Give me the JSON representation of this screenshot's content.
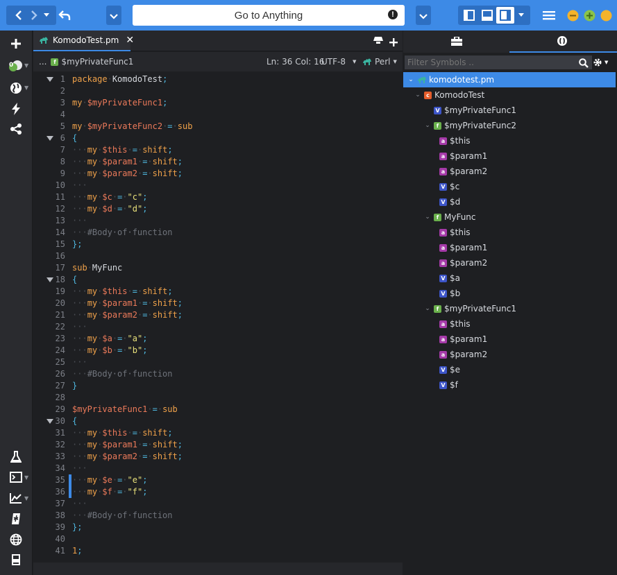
{
  "toolbar": {
    "goto_placeholder": "Go to Anything",
    "warning_glyph": "!"
  },
  "rail": {
    "badge_count": "0"
  },
  "editor_tab": {
    "filename": "KomodoTest.pm",
    "close": "✕"
  },
  "breadcrumb": {
    "ellipsis": "...",
    "symbol": "$myPrivateFunc1",
    "position": "Ln: 36 Col: 16",
    "encoding": "UTF-8",
    "language": "Perl"
  },
  "code_lines": [
    {
      "n": "1",
      "fold": true,
      "parts": [
        [
          "kw",
          "package"
        ],
        [
          "ws",
          "·"
        ],
        [
          "plain",
          "KomodoTest"
        ],
        [
          "op",
          ";"
        ]
      ]
    },
    {
      "n": "2",
      "parts": []
    },
    {
      "n": "3",
      "parts": [
        [
          "kw",
          "my"
        ],
        [
          "ws",
          "·"
        ],
        [
          "var",
          "$myPrivateFunc1"
        ],
        [
          "op",
          ";"
        ]
      ]
    },
    {
      "n": "4",
      "parts": []
    },
    {
      "n": "5",
      "parts": [
        [
          "kw",
          "my"
        ],
        [
          "ws",
          "·"
        ],
        [
          "var",
          "$myPrivateFunc2"
        ],
        [
          "ws",
          "·"
        ],
        [
          "op",
          "="
        ],
        [
          "ws",
          "·"
        ],
        [
          "kw",
          "sub"
        ]
      ]
    },
    {
      "n": "6",
      "fold": true,
      "parts": [
        [
          "op",
          "{"
        ]
      ]
    },
    {
      "n": "7",
      "parts": [
        [
          "ws",
          "···"
        ],
        [
          "kw",
          "my"
        ],
        [
          "ws",
          "·"
        ],
        [
          "var",
          "$this"
        ],
        [
          "ws",
          "·"
        ],
        [
          "op",
          "="
        ],
        [
          "ws",
          "·"
        ],
        [
          "kw",
          "shift"
        ],
        [
          "op",
          ";"
        ]
      ]
    },
    {
      "n": "8",
      "parts": [
        [
          "ws",
          "···"
        ],
        [
          "kw",
          "my"
        ],
        [
          "ws",
          "·"
        ],
        [
          "var",
          "$param1"
        ],
        [
          "ws",
          "·"
        ],
        [
          "op",
          "="
        ],
        [
          "ws",
          "·"
        ],
        [
          "kw",
          "shift"
        ],
        [
          "op",
          ";"
        ]
      ]
    },
    {
      "n": "9",
      "parts": [
        [
          "ws",
          "···"
        ],
        [
          "kw",
          "my"
        ],
        [
          "ws",
          "·"
        ],
        [
          "var",
          "$param2"
        ],
        [
          "ws",
          "·"
        ],
        [
          "op",
          "="
        ],
        [
          "ws",
          "·"
        ],
        [
          "kw",
          "shift"
        ],
        [
          "op",
          ";"
        ]
      ]
    },
    {
      "n": "10",
      "parts": [
        [
          "ws",
          "···"
        ]
      ]
    },
    {
      "n": "11",
      "parts": [
        [
          "ws",
          "···"
        ],
        [
          "kw",
          "my"
        ],
        [
          "ws",
          "·"
        ],
        [
          "var",
          "$c"
        ],
        [
          "ws",
          "·"
        ],
        [
          "op",
          "="
        ],
        [
          "ws",
          "·"
        ],
        [
          "str",
          "\"c\""
        ],
        [
          "op",
          ";"
        ]
      ]
    },
    {
      "n": "12",
      "parts": [
        [
          "ws",
          "···"
        ],
        [
          "kw",
          "my"
        ],
        [
          "ws",
          "·"
        ],
        [
          "var",
          "$d"
        ],
        [
          "ws",
          "·"
        ],
        [
          "op",
          "="
        ],
        [
          "ws",
          "·"
        ],
        [
          "str",
          "\"d\""
        ],
        [
          "op",
          ";"
        ]
      ]
    },
    {
      "n": "13",
      "parts": [
        [
          "ws",
          "···"
        ]
      ]
    },
    {
      "n": "14",
      "parts": [
        [
          "ws",
          "···"
        ],
        [
          "cm",
          "#Body·of·function"
        ]
      ]
    },
    {
      "n": "15",
      "parts": [
        [
          "op",
          "};"
        ]
      ]
    },
    {
      "n": "16",
      "parts": []
    },
    {
      "n": "17",
      "parts": [
        [
          "kw",
          "sub"
        ],
        [
          "ws",
          "·"
        ],
        [
          "plain",
          "MyFunc"
        ]
      ]
    },
    {
      "n": "18",
      "fold": true,
      "parts": [
        [
          "op",
          "{"
        ]
      ]
    },
    {
      "n": "19",
      "parts": [
        [
          "ws",
          "···"
        ],
        [
          "kw",
          "my"
        ],
        [
          "ws",
          "·"
        ],
        [
          "var",
          "$this"
        ],
        [
          "ws",
          "·"
        ],
        [
          "op",
          "="
        ],
        [
          "ws",
          "·"
        ],
        [
          "kw",
          "shift"
        ],
        [
          "op",
          ";"
        ]
      ]
    },
    {
      "n": "20",
      "parts": [
        [
          "ws",
          "···"
        ],
        [
          "kw",
          "my"
        ],
        [
          "ws",
          "·"
        ],
        [
          "var",
          "$param1"
        ],
        [
          "ws",
          "·"
        ],
        [
          "op",
          "="
        ],
        [
          "ws",
          "·"
        ],
        [
          "kw",
          "shift"
        ],
        [
          "op",
          ";"
        ]
      ]
    },
    {
      "n": "21",
      "parts": [
        [
          "ws",
          "···"
        ],
        [
          "kw",
          "my"
        ],
        [
          "ws",
          "·"
        ],
        [
          "var",
          "$param2"
        ],
        [
          "ws",
          "·"
        ],
        [
          "op",
          "="
        ],
        [
          "ws",
          "·"
        ],
        [
          "kw",
          "shift"
        ],
        [
          "op",
          ";"
        ]
      ]
    },
    {
      "n": "22",
      "parts": [
        [
          "ws",
          "···"
        ]
      ]
    },
    {
      "n": "23",
      "parts": [
        [
          "ws",
          "···"
        ],
        [
          "kw",
          "my"
        ],
        [
          "ws",
          "·"
        ],
        [
          "var",
          "$a"
        ],
        [
          "ws",
          "·"
        ],
        [
          "op",
          "="
        ],
        [
          "ws",
          "·"
        ],
        [
          "str",
          "\"a\""
        ],
        [
          "op",
          ";"
        ]
      ]
    },
    {
      "n": "24",
      "parts": [
        [
          "ws",
          "···"
        ],
        [
          "kw",
          "my"
        ],
        [
          "ws",
          "·"
        ],
        [
          "var",
          "$b"
        ],
        [
          "ws",
          "·"
        ],
        [
          "op",
          "="
        ],
        [
          "ws",
          "·"
        ],
        [
          "str",
          "\"b\""
        ],
        [
          "op",
          ";"
        ]
      ]
    },
    {
      "n": "25",
      "parts": [
        [
          "ws",
          "···"
        ]
      ]
    },
    {
      "n": "26",
      "parts": [
        [
          "ws",
          "···"
        ],
        [
          "cm",
          "#Body·of·function"
        ]
      ]
    },
    {
      "n": "27",
      "parts": [
        [
          "op",
          "}"
        ]
      ]
    },
    {
      "n": "28",
      "parts": []
    },
    {
      "n": "29",
      "parts": [
        [
          "var",
          "$myPrivateFunc1"
        ],
        [
          "ws",
          "·"
        ],
        [
          "op",
          "="
        ],
        [
          "ws",
          "·"
        ],
        [
          "kw",
          "sub"
        ]
      ]
    },
    {
      "n": "30",
      "fold": true,
      "parts": [
        [
          "op",
          "{"
        ]
      ]
    },
    {
      "n": "31",
      "parts": [
        [
          "ws",
          "···"
        ],
        [
          "kw",
          "my"
        ],
        [
          "ws",
          "·"
        ],
        [
          "var",
          "$this"
        ],
        [
          "ws",
          "·"
        ],
        [
          "op",
          "="
        ],
        [
          "ws",
          "·"
        ],
        [
          "kw",
          "shift"
        ],
        [
          "op",
          ";"
        ]
      ]
    },
    {
      "n": "32",
      "parts": [
        [
          "ws",
          "···"
        ],
        [
          "kw",
          "my"
        ],
        [
          "ws",
          "·"
        ],
        [
          "var",
          "$param1"
        ],
        [
          "ws",
          "·"
        ],
        [
          "op",
          "="
        ],
        [
          "ws",
          "·"
        ],
        [
          "kw",
          "shift"
        ],
        [
          "op",
          ";"
        ]
      ]
    },
    {
      "n": "33",
      "parts": [
        [
          "ws",
          "···"
        ],
        [
          "kw",
          "my"
        ],
        [
          "ws",
          "·"
        ],
        [
          "var",
          "$param2"
        ],
        [
          "ws",
          "·"
        ],
        [
          "op",
          "="
        ],
        [
          "ws",
          "·"
        ],
        [
          "kw",
          "shift"
        ],
        [
          "op",
          ";"
        ]
      ]
    },
    {
      "n": "34",
      "parts": [
        [
          "ws",
          "···"
        ]
      ]
    },
    {
      "n": "35",
      "mark": true,
      "parts": [
        [
          "ws",
          "···"
        ],
        [
          "kw",
          "my"
        ],
        [
          "ws",
          "·"
        ],
        [
          "var",
          "$e"
        ],
        [
          "ws",
          "·"
        ],
        [
          "op",
          "="
        ],
        [
          "ws",
          "·"
        ],
        [
          "str",
          "\"e\""
        ],
        [
          "op",
          ";"
        ]
      ]
    },
    {
      "n": "36",
      "mark": true,
      "parts": [
        [
          "ws",
          "···"
        ],
        [
          "kw",
          "my"
        ],
        [
          "ws",
          "·"
        ],
        [
          "var",
          "$f"
        ],
        [
          "ws",
          "·"
        ],
        [
          "op",
          "="
        ],
        [
          "ws",
          "·"
        ],
        [
          "str",
          "\"f\""
        ],
        [
          "op",
          ";"
        ]
      ]
    },
    {
      "n": "37",
      "parts": [
        [
          "ws",
          "···"
        ]
      ]
    },
    {
      "n": "38",
      "parts": [
        [
          "ws",
          "···"
        ],
        [
          "cm",
          "#Body·of·function"
        ]
      ]
    },
    {
      "n": "39",
      "parts": [
        [
          "op",
          "};"
        ]
      ]
    },
    {
      "n": "40",
      "parts": []
    },
    {
      "n": "41",
      "parts": [
        [
          "kw",
          "1"
        ],
        [
          "op",
          ";"
        ]
      ]
    }
  ],
  "symbols": {
    "filter_placeholder": "Filter Symbols ..",
    "tree": [
      {
        "label": "komodotest.pm",
        "kind": "file",
        "depth": 0,
        "open": true
      },
      {
        "label": "KomodoTest",
        "kind": "c",
        "depth": 1,
        "open": true
      },
      {
        "label": "$myPrivateFunc1",
        "kind": "v",
        "depth": 2
      },
      {
        "label": "$myPrivateFunc2",
        "kind": "f",
        "depth": 2,
        "open": true
      },
      {
        "label": "$this",
        "kind": "a",
        "depth": 3
      },
      {
        "label": "$param1",
        "kind": "a",
        "depth": 3
      },
      {
        "label": "$param2",
        "kind": "a",
        "depth": 3
      },
      {
        "label": "$c",
        "kind": "v",
        "depth": 3
      },
      {
        "label": "$d",
        "kind": "v",
        "depth": 3
      },
      {
        "label": "MyFunc",
        "kind": "f",
        "depth": 2,
        "open": true
      },
      {
        "label": "$this",
        "kind": "a",
        "depth": 3
      },
      {
        "label": "$param1",
        "kind": "a",
        "depth": 3
      },
      {
        "label": "$param2",
        "kind": "a",
        "depth": 3
      },
      {
        "label": "$a",
        "kind": "v",
        "depth": 3
      },
      {
        "label": "$b",
        "kind": "v",
        "depth": 3
      },
      {
        "label": "$myPrivateFunc1",
        "kind": "f",
        "depth": 2,
        "open": true
      },
      {
        "label": "$this",
        "kind": "a",
        "depth": 3
      },
      {
        "label": "$param1",
        "kind": "a",
        "depth": 3
      },
      {
        "label": "$param2",
        "kind": "a",
        "depth": 3
      },
      {
        "label": "$e",
        "kind": "v",
        "depth": 3
      },
      {
        "label": "$f",
        "kind": "v",
        "depth": 3
      }
    ]
  },
  "colors": {
    "accent": "#3d8ae6",
    "minimize": "#f4b32b",
    "maximize": "#8bc34a",
    "close": "#f4b32b"
  }
}
